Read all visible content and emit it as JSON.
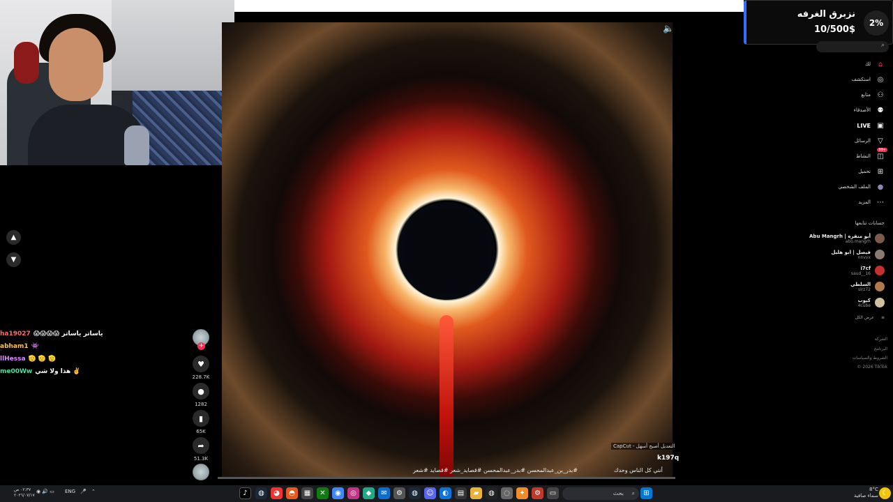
{
  "donation": {
    "percent": "2%",
    "title": "نزبرق الغرفه",
    "amount": "10/500$"
  },
  "video": {
    "brand": "CapCut - التعديل أصبح أسهل",
    "username": "k197q",
    "caption": "أنتي كل الناس وحدك",
    "hashtags": "#بدر_بن_عبدالمحسن #بدر_عبدالمحسن #قصايد_شعر #قصايد #شعر",
    "progress": 0
  },
  "actions": {
    "likes": "228.7K",
    "comments": "1282",
    "saves": "65K",
    "shares": "51.3K"
  },
  "chat": [
    {
      "user": "ha19027",
      "msg": "😱😱😱😱 ياساتر ياساتر"
    },
    {
      "user": "abham1",
      "msg": "👾"
    },
    {
      "user": "llHessa",
      "msg": "🫡 🫡 🫡"
    },
    {
      "user": "me00Ww",
      "msg": "هذا ولا شي ✌️"
    }
  ],
  "sidebar": {
    "items": [
      {
        "label": "لك",
        "icon": "home-icon",
        "glyph": "⌂"
      },
      {
        "label": "استكشف",
        "icon": "compass-icon",
        "glyph": "◎"
      },
      {
        "label": "متابع",
        "icon": "user-check-icon",
        "glyph": "⚇"
      },
      {
        "label": "الأصدقاء",
        "icon": "friends-icon",
        "glyph": "⚉"
      },
      {
        "label": "LIVE",
        "icon": "live-icon",
        "glyph": "▣"
      },
      {
        "label": "الرسائل",
        "icon": "send-icon",
        "glyph": "▽"
      },
      {
        "label": "النشاط",
        "icon": "activity-icon",
        "glyph": "◫"
      },
      {
        "label": "تحميل",
        "icon": "upload-icon",
        "glyph": "⊞"
      },
      {
        "label": "الملف الشخصي",
        "icon": "profile-icon",
        "glyph": "●"
      },
      {
        "label": "المزيد",
        "icon": "more-icon",
        "glyph": "⋯"
      }
    ],
    "activity_badge": "99+",
    "following_heading": "حسابات تتابعها",
    "accounts": [
      {
        "name": "Abu Mangrh | أبو منقره",
        "handle": "abo.mangrh",
        "color": "#7a5a4a"
      },
      {
        "name": "فيصل | ابو هليل",
        "handle": "nnvvx",
        "color": "#8a7a70"
      },
      {
        "name": "i7cf",
        "handle": "saud__16",
        "color": "#c43030"
      },
      {
        "name": "السلطي",
        "handle": "slrz72",
        "color": "#b07a4a"
      },
      {
        "name": "كيوب",
        "handle": "4cube",
        "color": "#d0c0a0"
      }
    ],
    "see_all": "عرض الكل",
    "footer": [
      "الشركة",
      "البرنامج",
      "الشروط والسياسات",
      "© 2026 TikTok"
    ]
  },
  "taskbar": {
    "search_placeholder": "بحث",
    "lang": "ENG",
    "time": "٠٢:٣٧ ص",
    "date": "٢٠٢٦/٠٧/١٧",
    "temp": "8°C",
    "weather": "سماء صافية"
  }
}
